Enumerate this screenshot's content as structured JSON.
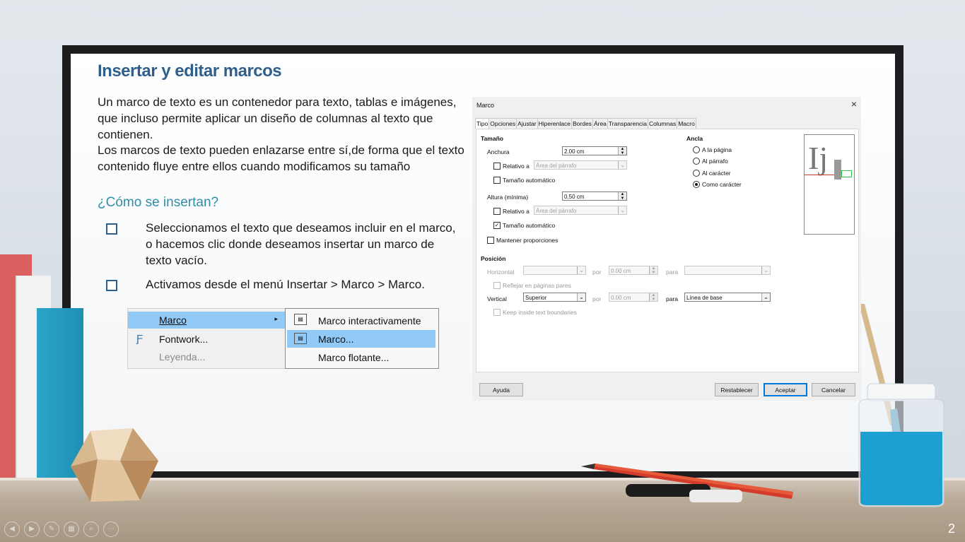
{
  "slide": {
    "title": "Insertar y editar marcos",
    "paragraph1": "Un marco de texto es un contenedor para texto, tablas e imágenes, que incluso permite aplicar un diseño de columnas al texto que contienen.",
    "paragraph2": "Los marcos de texto pueden enlazarse entre sí,de forma que el texto contenido fluye entre ellos cuando modificamos su tamaño",
    "subtitle": "¿Cómo se insertan?",
    "bullets": [
      "Seleccionamos el texto que deseamos incluir en el marco, o hacemos clic donde deseamos insertar un marco de texto vacío.",
      "Activamos desde el menú Insertar > Marco > Marco."
    ],
    "slide_number": "2"
  },
  "menu": {
    "items": [
      "Marco",
      "Fontwork...",
      "Leyenda..."
    ],
    "submenu": [
      "Marco interactivamente",
      "Marco...",
      "Marco flotante..."
    ]
  },
  "dialog": {
    "title": "Marco",
    "close": "×",
    "tabs": [
      "Tipo",
      "Opciones",
      "Ajustar",
      "Hiperenlace",
      "Bordes",
      "Área",
      "Transparencia",
      "Columnas",
      "Macro"
    ],
    "size": {
      "heading": "Tamaño",
      "width_label": "Anchura",
      "width_value": "2.00 cm",
      "relative_label": "Relativo a",
      "relative_value": "Área del párrafo",
      "auto_label": "Tamaño automático",
      "height_label": "Altura (mínima)",
      "height_value": "0.50 cm",
      "relative2_label": "Relativo a",
      "relative2_value": "Área del párrafo",
      "auto2_label": "Tamaño automático",
      "keep_label": "Mantener proporciones"
    },
    "anchor": {
      "heading": "Ancla",
      "options": [
        "A la página",
        "Al párrafo",
        "Al carácter",
        "Como carácter"
      ],
      "selected": "Como carácter"
    },
    "position": {
      "heading": "Posición",
      "horizontal_label": "Horizontal",
      "by_label": "por",
      "by_value": "0.00 cm",
      "to_label": "para",
      "mirror_label": "Reflejar en páginas pares",
      "vertical_label": "Vertical",
      "vertical_value": "Superior",
      "by2_value": "0.00 cm",
      "to2_label": "para",
      "to2_value": "Línea de base",
      "keep_inside_label": "Keep inside text boundaries"
    },
    "buttons": {
      "help": "Ayuda",
      "reset": "Restablecer",
      "ok": "Aceptar",
      "cancel": "Cancelar"
    },
    "preview_text": "Ij"
  },
  "colors": {
    "title": "#2f5f8a",
    "subtitle": "#2e8eaa",
    "menu_highlight": "#91c9f7"
  }
}
